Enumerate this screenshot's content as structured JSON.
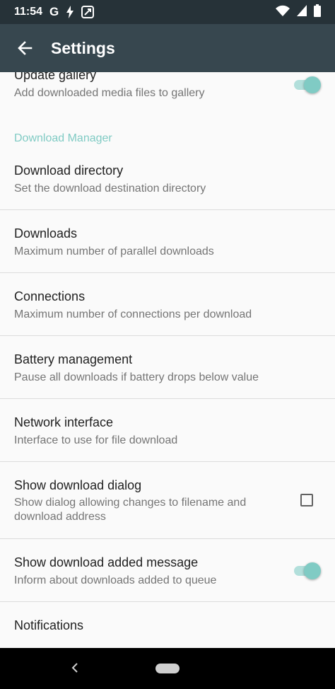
{
  "status_bar": {
    "time": "11:54",
    "icons": [
      "google-icon",
      "flash-icon",
      "screenshot-icon",
      "wifi-icon",
      "signal-icon",
      "battery-icon"
    ]
  },
  "app_bar": {
    "title": "Settings",
    "back_icon": "arrow-back-icon"
  },
  "preferences": {
    "update_gallery": {
      "title": "Update gallery",
      "summary": "Add downloaded media files to gallery",
      "switch_on": true
    },
    "category": "Download Manager",
    "download_directory": {
      "title": "Download directory",
      "summary": "Set the download destination directory"
    },
    "downloads": {
      "title": "Downloads",
      "summary": "Maximum number of parallel downloads"
    },
    "connections": {
      "title": "Connections",
      "summary": "Maximum number of connections per download"
    },
    "battery": {
      "title": "Battery management",
      "summary": "Pause all downloads if battery drops below value"
    },
    "network": {
      "title": "Network interface",
      "summary": "Interface to use for file download"
    },
    "show_dialog": {
      "title": "Show download dialog",
      "summary": "Show dialog allowing changes to filename and download address",
      "checked": false
    },
    "show_added": {
      "title": "Show download added message",
      "summary": "Inform about downloads added to queue",
      "switch_on": true
    },
    "notifications": {
      "title": "Notifications"
    }
  },
  "colors": {
    "status_bar": "#263238",
    "app_bar": "#37474f",
    "accent": "#80cbc4",
    "accent_track": "#b2dfdb",
    "background": "#fafafa"
  },
  "nav_bar": {
    "icons": [
      "nav-back-icon",
      "home-pill-icon"
    ]
  }
}
